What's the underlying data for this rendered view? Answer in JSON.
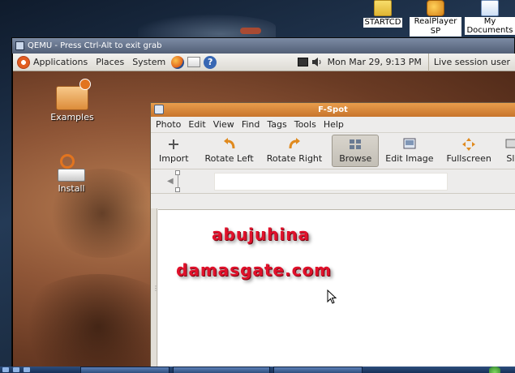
{
  "host_desktop": {
    "icons": [
      {
        "label": "STARTCD",
        "icon": "folder-icon"
      },
      {
        "label": "RealPlayer SP",
        "icon": "realplayer-icon"
      },
      {
        "label": "My Documents",
        "label_line1": "My",
        "label_line2": "Documents",
        "icon": "documents-icon"
      }
    ]
  },
  "qemu": {
    "title": "QEMU - Press Ctrl-Alt to exit grab"
  },
  "gnome_panel": {
    "menus": [
      "Applications",
      "Places",
      "System"
    ],
    "clock": "Mon Mar 29,  9:13 PM",
    "session": "Live session user"
  },
  "guest_desktop": {
    "icons": [
      {
        "label": "Examples",
        "icon": "examples-folder-icon"
      },
      {
        "label": "Install",
        "icon": "install-icon"
      }
    ]
  },
  "fspot": {
    "title": "F-Spot",
    "menu": [
      "Photo",
      "Edit",
      "View",
      "Find",
      "Tags",
      "Tools",
      "Help"
    ],
    "toolbar": [
      {
        "label": "Import",
        "icon": "import-icon"
      },
      {
        "label": "Rotate Left",
        "icon": "rotate-left-icon"
      },
      {
        "label": "Rotate Right",
        "icon": "rotate-right-icon"
      },
      {
        "label": "Browse",
        "icon": "browse-icon",
        "active": true
      },
      {
        "label": "Edit Image",
        "icon": "edit-image-icon"
      },
      {
        "label": "Fullscreen",
        "icon": "fullscreen-icon"
      },
      {
        "label": "Sli",
        "icon": "slideshow-icon"
      }
    ]
  },
  "watermark": {
    "line1": "abujuhina",
    "line2": "damasgate.com"
  },
  "colors": {
    "fspot_title": "#d9863c",
    "ubuntu_orange": "#e25d21",
    "watermark_red": "#e0112b"
  }
}
